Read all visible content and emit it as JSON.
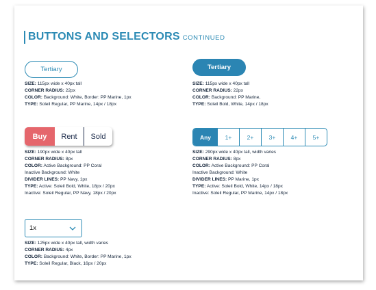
{
  "page": {
    "title": "BUTTONS AND SELECTORS",
    "title_suffix": "CONTINUED"
  },
  "colors": {
    "marine": "#2b8ab4",
    "coral": "#e5666c",
    "navy": "#1c2b4a"
  },
  "tertiary_outline": {
    "label": "Tertiary",
    "specs": [
      {
        "label": "SIZE:",
        "value": " 115px wide x 40px tall"
      },
      {
        "label": "CORNER RADIUS:",
        "value": " 22px"
      },
      {
        "label": "COLOR:",
        "value": " Background: White, Border: PP Marine, 1px"
      },
      {
        "label": "TYPE:",
        "value": " Soleil Regular, PP Marine, 14px / 18px"
      }
    ]
  },
  "tertiary_filled": {
    "label": "Tertiary",
    "specs": [
      {
        "label": "SIZE:",
        "value": " 115px wide x 40px tall"
      },
      {
        "label": "CORNER RADIUS:",
        "value": " 22px"
      },
      {
        "label": "COLOR:",
        "value": " Background: PP Marine,"
      },
      {
        "label": "TYPE:",
        "value": " Soleil Bold, White, 14px / 18px"
      }
    ]
  },
  "segmented_coral": {
    "options": [
      "Buy",
      "Rent",
      "Sold"
    ],
    "specs": [
      {
        "label": "SIZE:",
        "value": " 190px wide x 40px tall"
      },
      {
        "label": "CORNER RADIUS:",
        "value": " 8px"
      },
      {
        "label": "COLOR:",
        "value": " Active Background: PP Coral"
      },
      {
        "label": "",
        "value": "Inactive Background: White"
      },
      {
        "label": "DIVIDER LINES:",
        "value": " PP Navy, 1px"
      },
      {
        "label": "TYPE:",
        "value": " Active: Soleil Bold, White, 18px / 20px"
      },
      {
        "label": "",
        "value": "Inactive: Soleil Regular, PP Navy, 18px / 20px"
      }
    ]
  },
  "segmented_marine": {
    "options": [
      "Any",
      "1+",
      "2+",
      "3+",
      "4+",
      "5+"
    ],
    "specs": [
      {
        "label": "SIZE:",
        "value": " 290px wide x 40px tall, width varies"
      },
      {
        "label": "CORNER RADIUS:",
        "value": " 8px"
      },
      {
        "label": "COLOR:",
        "value": " Active Background: PP Coral"
      },
      {
        "label": "",
        "value": "Inactive Background: White"
      },
      {
        "label": "DIVIDER LINES:",
        "value": " PP Marine, 1px"
      },
      {
        "label": "TYPE:",
        "value": " Active: Soleil Bold, White, 14px / 18px"
      },
      {
        "label": "",
        "value": "Inactive: Soleil Regular, PP Marine, 14px / 18px"
      }
    ]
  },
  "dropdown": {
    "value": "1x",
    "icon": "chevron-down-icon",
    "specs": [
      {
        "label": "SIZE:",
        "value": " 125px wide x 40px tall, width varies"
      },
      {
        "label": "CORNER RADIUS:",
        "value": " 4px"
      },
      {
        "label": "COLOR:",
        "value": " Background: White, Border: PP Marine, 1px"
      },
      {
        "label": "TYPE:",
        "value": " Soleil Regular, Black, 16px / 20px"
      }
    ]
  }
}
